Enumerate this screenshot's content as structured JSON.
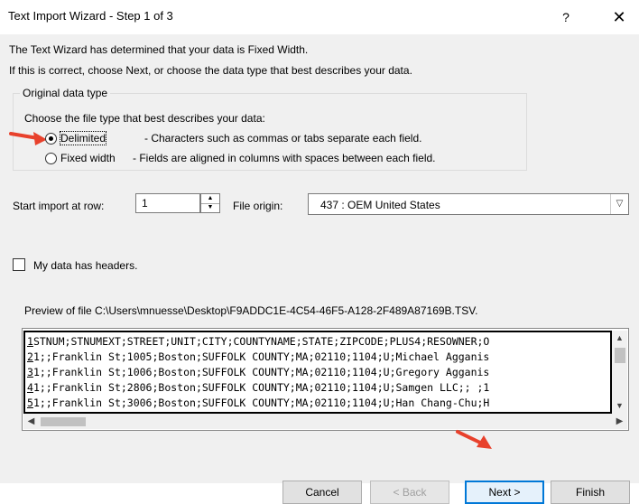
{
  "window": {
    "title": "Text Import Wizard - Step 1 of 3",
    "help": "?",
    "close": "✕"
  },
  "intro": {
    "line1": "The Text Wizard has determined that your data is Fixed Width.",
    "line2": "If this is correct, choose Next, or choose the data type that best describes your data."
  },
  "original_data_type": {
    "legend": "Original data type",
    "prompt": "Choose the file type that best describes your data:",
    "options": [
      {
        "label": "Delimited",
        "description": "- Characters such as commas or tabs separate each field.",
        "selected": true
      },
      {
        "label": "Fixed width",
        "description": "- Fields are aligned in columns with spaces between each field.",
        "selected": false
      }
    ]
  },
  "start_row": {
    "label": "Start import at row:",
    "value": "1"
  },
  "file_origin": {
    "label": "File origin:",
    "value": "437 : OEM United States"
  },
  "headers": {
    "label": "My data has headers.",
    "checked": false
  },
  "preview": {
    "label": "Preview of file C:\\Users\\mnuesse\\Desktop\\F9ADDC1E-4C54-46F5-A128-2F489A87169B.TSV.",
    "rows": [
      {
        "num": "1",
        "text": "STNUM;STNUMEXT;STREET;UNIT;CITY;COUNTYNAME;STATE;ZIPCODE;PLUS4;RESOWNER;O"
      },
      {
        "num": "2",
        "text": "1;;Franklin St;1005;Boston;SUFFOLK COUNTY;MA;02110;1104;U;Michael Agganis"
      },
      {
        "num": "3",
        "text": "1;;Franklin St;1006;Boston;SUFFOLK COUNTY;MA;02110;1104;U;Gregory Agganis"
      },
      {
        "num": "4",
        "text": "1;;Franklin St;2806;Boston;SUFFOLK COUNTY;MA;02110;1104;U;Samgen LLC;; ;1"
      },
      {
        "num": "5",
        "text": "1;;Franklin St;3006;Boston;SUFFOLK COUNTY;MA;02110;1104;U;Han Chang-Chu;H"
      }
    ]
  },
  "buttons": {
    "cancel": "Cancel",
    "back": "< Back",
    "next": "Next >",
    "finish": "Finish"
  },
  "colors": {
    "annotation_arrow": "#e8412c",
    "default_button_border": "#0078d7",
    "dialog_background": "#f0f0f0"
  }
}
